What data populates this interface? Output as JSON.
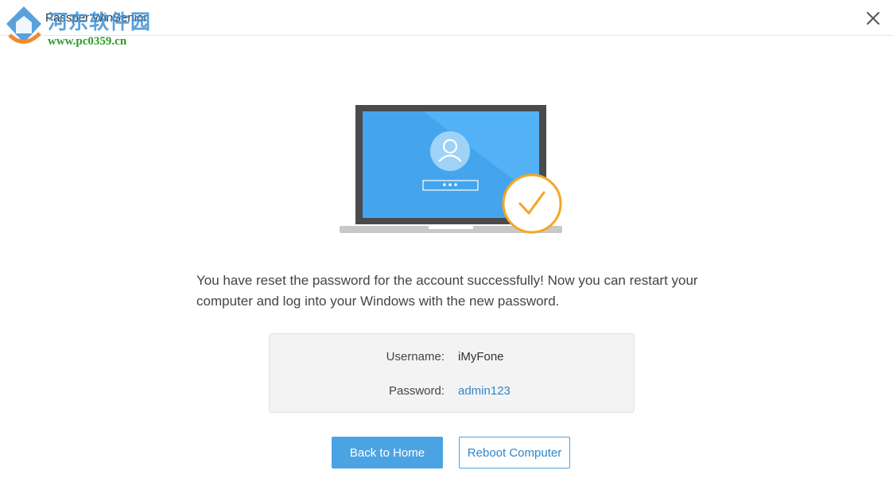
{
  "window": {
    "title": "Passper WinSenior",
    "watermark_cn": "河东软件园",
    "watermark_url": "www.pc0359.cn"
  },
  "icons": {
    "close": "close-icon",
    "logo": "app-logo-icon",
    "user": "user-icon",
    "check": "checkmark-icon"
  },
  "main": {
    "password_dots": "•••",
    "message": "You have reset the password for the account successfully! Now you can restart your computer and log into your Windows with the new password."
  },
  "credentials": {
    "username_label": "Username:",
    "username_value": "iMyFone",
    "password_label": "Password:",
    "password_value": "admin123"
  },
  "buttons": {
    "back": "Back to Home",
    "reboot": "Reboot Computer"
  },
  "colors": {
    "accent": "#4ca3e3",
    "link": "#2f86c8",
    "success_ring": "#f5a623",
    "screen": "#4aa8ec"
  }
}
